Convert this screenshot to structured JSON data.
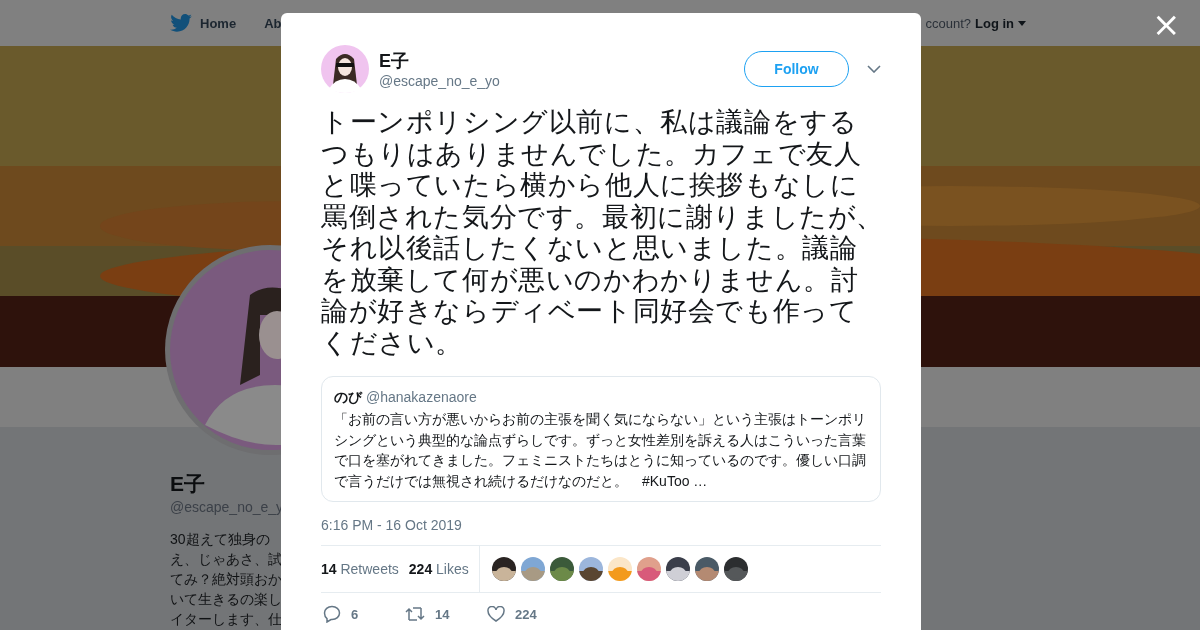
{
  "nav": {
    "items": [
      {
        "label": "Home"
      },
      {
        "label": "Ab"
      }
    ],
    "account_prompt": "ccount?",
    "login": "Log in"
  },
  "profile": {
    "name": "E子",
    "handle": "@escape_no_e_y",
    "bio_lines": [
      "30超えて独身の",
      "え、じゃあさ、試",
      "てみ？絶対頭おか",
      "いて生きるの楽し",
      "イターします、仕"
    ]
  },
  "close_label": "×",
  "tweet": {
    "author": {
      "name": "E子",
      "handle": "@escape_no_e_yo"
    },
    "follow_label": "Follow",
    "text": "トーンポリシング以前に、私は議論をするつもりはありませんでした。カフェで友人と喋っていたら横から他人に挨拶もなしに罵倒された気分です。最初に謝りましたが、それ以後話したくないと思いました。議論を放棄して何が悪いのかわかりません。討論が好きならディベート同好会でも作ってください。",
    "quote": {
      "name": "のび",
      "handle": "@hanakazenaore",
      "text": "「お前の言い方が悪いからお前の主張を聞く気にならない」という主張はトーンポリシングという典型的な論点ずらしです。ずっと女性差別を訴える人はこういった言葉で口を塞がれてきました。フェミニストたちはとうに知っているのです。優しい口調で言うだけでは無視され続けるだけなのだと。　#KuToo …"
    },
    "timestamp": "6:16 PM - 16 Oct 2019",
    "stats": [
      {
        "count": "14",
        "label": "Retweets"
      },
      {
        "count": "224",
        "label": "Likes"
      }
    ],
    "actions": [
      {
        "kind": "reply",
        "count": "6"
      },
      {
        "kind": "retweet",
        "count": "14"
      },
      {
        "kind": "like",
        "count": "224"
      }
    ]
  }
}
